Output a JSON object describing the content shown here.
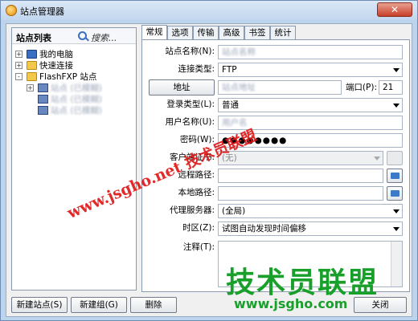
{
  "window": {
    "title": "站点管理器",
    "close_glyph": "✕"
  },
  "site_list": {
    "title": "站点列表",
    "search_label": "搜索...",
    "tree": [
      {
        "label": "我的电脑",
        "icon": "computer-icon",
        "expand": "+"
      },
      {
        "label": "快速连接",
        "icon": "folder-icon",
        "expand": "+"
      },
      {
        "label": "FlashFXP 站点",
        "icon": "folder-icon",
        "expand": "-"
      },
      {
        "label": "站点 (已模糊)",
        "icon": "server-icon",
        "expand": "+"
      },
      {
        "label": "站点 (已模糊)",
        "icon": "server-icon",
        "expand": ""
      },
      {
        "label": "站点 (已模糊)",
        "icon": "server-icon",
        "expand": ""
      }
    ]
  },
  "tabs": [
    "常规",
    "选项",
    "传输",
    "高级",
    "书签",
    "统计"
  ],
  "form": {
    "site_name_label": "站点名称(N):",
    "site_name_value": "站点名称",
    "conn_type_label": "连接类型:",
    "conn_type_value": "FTP",
    "address_button": "地址",
    "address_value": "站点地址",
    "port_label": "端口(P):",
    "port_value": "21",
    "login_type_label": "登录类型(L):",
    "login_type_value": "普通",
    "username_label": "用户名称(U):",
    "username_value": "用户名",
    "password_label": "密码(W):",
    "password_value": "●●●●●●●●",
    "client_cert_label": "客户端证书:",
    "client_cert_value": "(无)",
    "remote_path_label": "远程路径:",
    "local_path_label": "本地路径:",
    "proxy_label": "代理服务器:",
    "proxy_value": "(全局)",
    "timezone_label": "时区(Z):",
    "timezone_value": "试图自动发现时间偏移",
    "notes_label": "注释(T):"
  },
  "buttons": {
    "new_site": "新建站点(S)",
    "new_group": "新建组(G)",
    "delete": "删除",
    "close": "关闭"
  },
  "watermark": {
    "line1": "www.jsgho.net 技术员联盟",
    "line2": "技术员联盟",
    "line3": "www.jsgho.com"
  }
}
